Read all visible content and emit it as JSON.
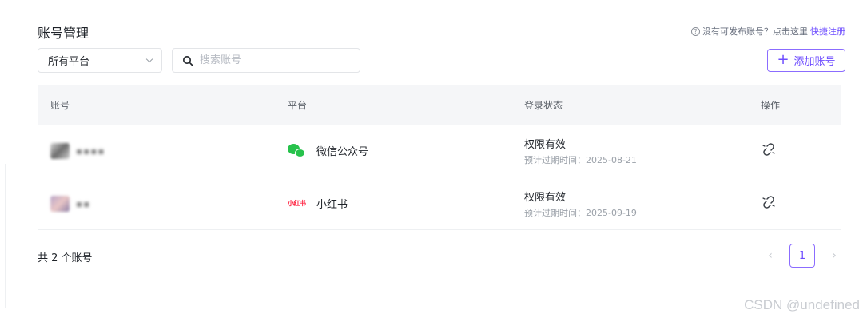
{
  "header": {
    "title": "账号管理",
    "help_text": "没有可发布账号？点击这里",
    "help_link": "快捷注册"
  },
  "filters": {
    "platform_select_value": "所有平台",
    "search_placeholder": "搜索账号"
  },
  "toolbar": {
    "add_label": "添加账号"
  },
  "table": {
    "columns": [
      "账号",
      "平台",
      "登录状态",
      "操作"
    ],
    "rows": [
      {
        "account": "▪▪▪▪",
        "platform": "微信公众号",
        "status": "权限有效",
        "expire": "预计过期时间：2025-08-21"
      },
      {
        "account": "▪▪",
        "platform": "小红书",
        "platform_logo": "小红书",
        "status": "权限有效",
        "expire": "预计过期时间：2025-09-19"
      }
    ]
  },
  "footer": {
    "count": "共 2 个账号",
    "current_page": "1"
  },
  "watermark": "CSDN @undefined",
  "colors": {
    "accent": "#6d4cff",
    "wechat": "#27c24c",
    "xiaohongshu": "#ff2442"
  }
}
